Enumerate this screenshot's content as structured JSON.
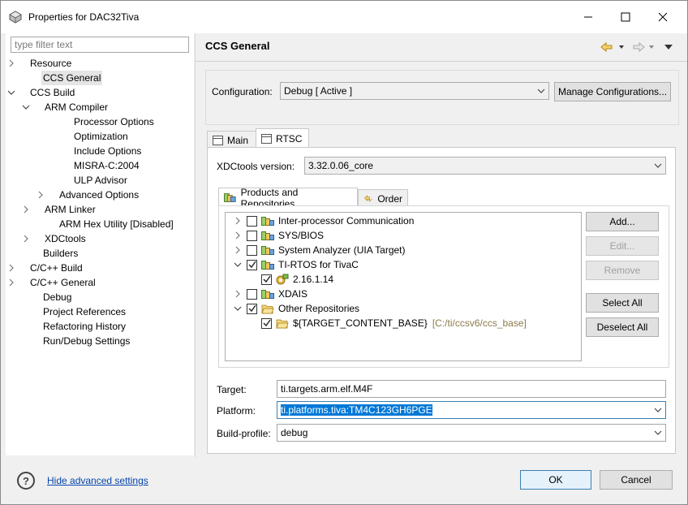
{
  "window": {
    "title": "Properties for DAC32Tiva",
    "controls": {
      "minimize": "—",
      "maximize": "☐",
      "close": "✕"
    }
  },
  "filter": {
    "placeholder": "type filter text"
  },
  "tree": [
    {
      "label": "Resource",
      "expandable": true,
      "expanded": false
    },
    {
      "label": "CCS General",
      "selected": true
    },
    {
      "label": "CCS Build",
      "expandable": true,
      "expanded": true
    },
    {
      "label": "ARM Compiler",
      "expandable": true,
      "expanded": true
    },
    {
      "label": "Processor Options"
    },
    {
      "label": "Optimization"
    },
    {
      "label": "Include Options"
    },
    {
      "label": "MISRA-C:2004"
    },
    {
      "label": "ULP Advisor"
    },
    {
      "label": "Advanced Options",
      "expandable": true,
      "expanded": false
    },
    {
      "label": "ARM Linker",
      "expandable": true,
      "expanded": false
    },
    {
      "label": "ARM Hex Utility  [Disabled]"
    },
    {
      "label": "XDCtools",
      "expandable": true,
      "expanded": false
    },
    {
      "label": "Builders"
    },
    {
      "label": "C/C++ Build",
      "expandable": true,
      "expanded": false
    },
    {
      "label": "C/C++ General",
      "expandable": true,
      "expanded": false
    },
    {
      "label": "Debug"
    },
    {
      "label": "Project References"
    },
    {
      "label": "Refactoring History"
    },
    {
      "label": "Run/Debug Settings"
    }
  ],
  "page": {
    "title": "CCS General"
  },
  "configuration": {
    "label": "Configuration:",
    "value": "Debug  [ Active ]",
    "manage_button": "Manage Configurations..."
  },
  "tabs": {
    "main": "Main",
    "rtsc": "RTSC"
  },
  "xdctools": {
    "label": "XDCtools version:",
    "value": "3.32.0.06_core"
  },
  "subtabs": {
    "products": "Products and Repositories",
    "order": "Order"
  },
  "repos": [
    {
      "label": "Inter-processor Communication",
      "checked": false,
      "expandable": true,
      "expanded": false
    },
    {
      "label": "SYS/BIOS",
      "checked": false,
      "expandable": true,
      "expanded": false
    },
    {
      "label": "System Analyzer (UIA Target)",
      "checked": false,
      "expandable": true,
      "expanded": false
    },
    {
      "label": "TI-RTOS for TivaC",
      "checked": true,
      "expandable": true,
      "expanded": true
    },
    {
      "label": "2.16.1.14",
      "checked": true
    },
    {
      "label": "XDAIS",
      "checked": false,
      "expandable": true,
      "expanded": false
    },
    {
      "label": "Other Repositories",
      "checked": true,
      "expandable": true,
      "expanded": true
    },
    {
      "label": "${TARGET_CONTENT_BASE}",
      "checked": true,
      "path": "[C:/ti/ccsv6/ccs_base]"
    }
  ],
  "repo_buttons": {
    "add": "Add...",
    "edit": "Edit...",
    "remove": "Remove",
    "select_all": "Select All",
    "deselect_all": "Deselect All"
  },
  "target": {
    "label": "Target:",
    "value": "ti.targets.arm.elf.M4F"
  },
  "platform": {
    "label": "Platform:",
    "value": "ti.platforms.tiva:TM4C123GH6PGE"
  },
  "build_profile": {
    "label": "Build-profile:",
    "value": "debug"
  },
  "footer": {
    "help": "?",
    "advanced_link": "Hide advanced settings",
    "ok": "OK",
    "cancel": "Cancel"
  }
}
